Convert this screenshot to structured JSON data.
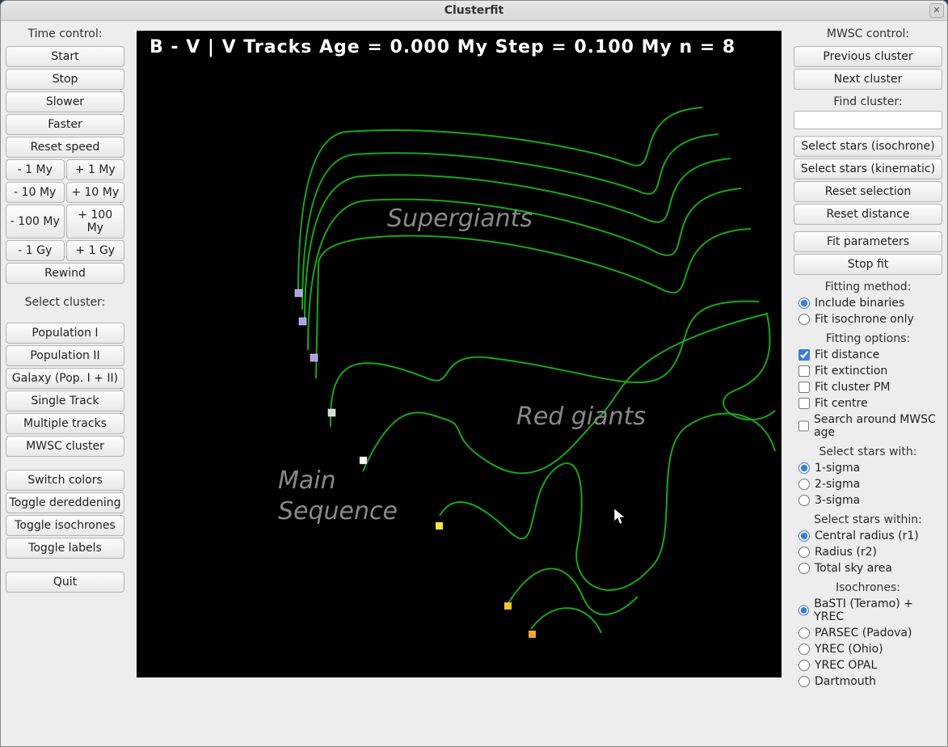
{
  "window_title": "Clusterfit",
  "left": {
    "time_control_label": "Time control:",
    "start": "Start",
    "stop": "Stop",
    "slower": "Slower",
    "faster": "Faster",
    "reset_speed": "Reset speed",
    "minus1my": "- 1 My",
    "plus1my": "+ 1 My",
    "minus10my": "- 10 My",
    "plus10my": "+ 10 My",
    "minus100my": "- 100 My",
    "plus100my": "+ 100 My",
    "minus1gy": "- 1 Gy",
    "plus1gy": "+ 1 Gy",
    "rewind": "Rewind",
    "select_cluster_label": "Select cluster:",
    "pop1": "Population I",
    "pop2": "Population II",
    "galaxy": "Galaxy (Pop. I + II)",
    "single_track": "Single Track",
    "multiple_tracks": "Multiple tracks",
    "mwsc_cluster": "MWSC cluster",
    "switch_colors": "Switch colors",
    "toggle_dereddening": "Toggle dereddening",
    "toggle_isochrones": "Toggle isochrones",
    "toggle_labels": "Toggle labels",
    "quit": "Quit"
  },
  "plot": {
    "title": "B - V | V  Tracks  Age = 0.000 My  Step = 0.100 My  n = 8",
    "labels": {
      "supergiants": "Supergiants",
      "red_giants": "Red giants",
      "main_sequence": "Main\nSequence"
    }
  },
  "right": {
    "mwsc_control_label": "MWSC control:",
    "prev_cluster": "Previous cluster",
    "next_cluster": "Next cluster",
    "find_cluster_label": "Find cluster:",
    "find_cluster_value": "",
    "select_iso": "Select stars (isochrone)",
    "select_kin": "Select stars (kinematic)",
    "reset_selection": "Reset selection",
    "reset_distance": "Reset distance",
    "fit_parameters": "Fit parameters",
    "stop_fit": "Stop fit",
    "fitting_method_label": "Fitting method:",
    "include_binaries": "Include binaries",
    "fit_isochrone_only": "Fit isochrone only",
    "fitting_options_label": "Fitting options:",
    "fit_distance": "Fit distance",
    "fit_extinction": "Fit extinction",
    "fit_cluster_pm": "Fit cluster PM",
    "fit_centre": "Fit centre",
    "search_mwsc_age": "Search around MWSC age",
    "select_stars_with_label": "Select stars with:",
    "sigma1": "1-sigma",
    "sigma2": "2-sigma",
    "sigma3": "3-sigma",
    "select_within_label": "Select stars within:",
    "central_radius": "Central radius (r1)",
    "radius_r2": "Radius (r2)",
    "total_sky": "Total sky area",
    "isochrones_label": "Isochrones:",
    "basti": "BaSTI (Teramo) + YREC",
    "parsec": "PARSEC (Padova)",
    "yrec_ohio": "YREC (Ohio)",
    "yrec_opal": "YREC OPAL",
    "dartmouth": "Dartmouth"
  }
}
